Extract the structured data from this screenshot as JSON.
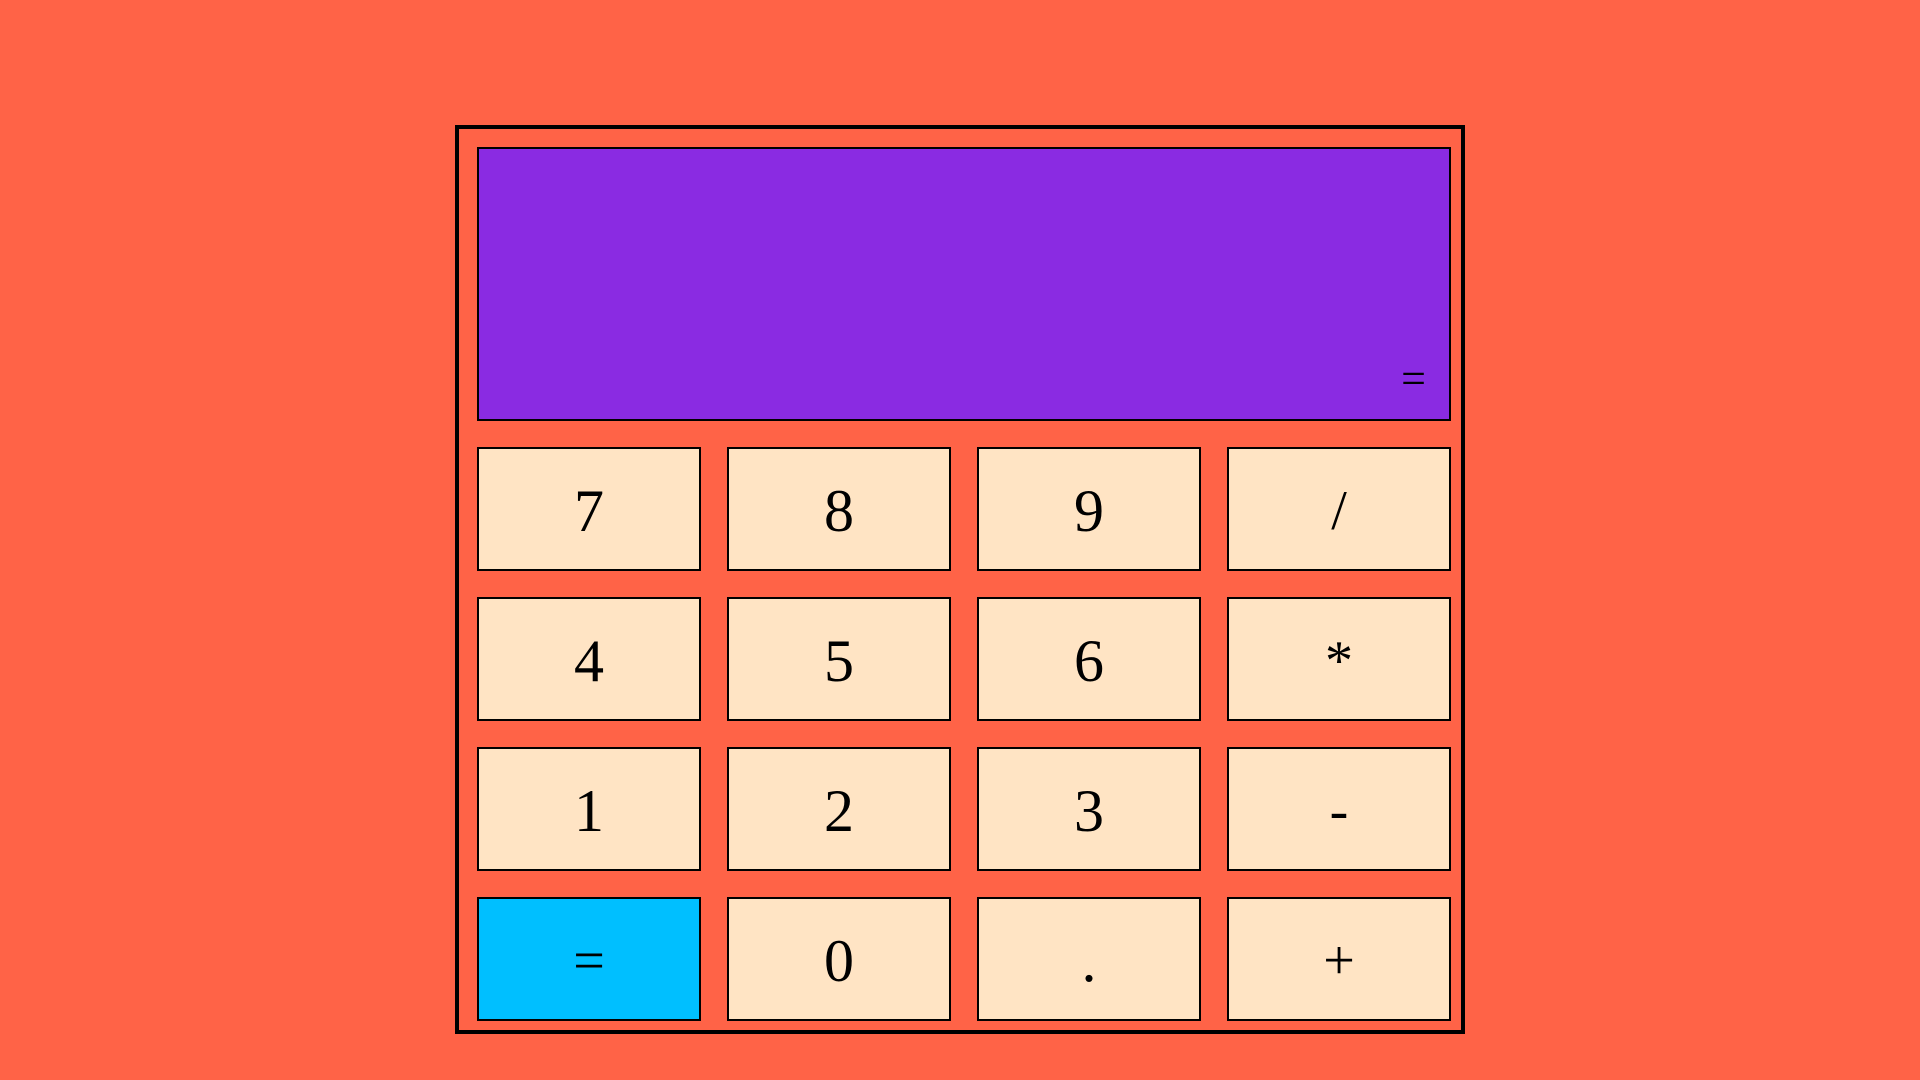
{
  "colors": {
    "page_background": "#ff6347",
    "display_background": "#8a2be2",
    "key_background": "#ffe4c4",
    "equals_key_background": "#00bfff",
    "border": "#000000"
  },
  "display": {
    "text": "="
  },
  "keys": {
    "row1": [
      "7",
      "8",
      "9",
      "/"
    ],
    "row2": [
      "4",
      "5",
      "6",
      "*"
    ],
    "row3": [
      "1",
      "2",
      "3",
      "-"
    ],
    "row4": [
      "=",
      "0",
      ".",
      "+"
    ]
  }
}
